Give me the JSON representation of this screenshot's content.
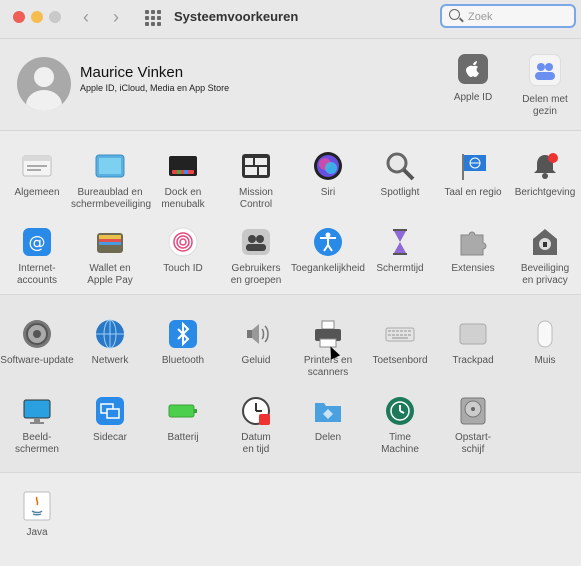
{
  "window": {
    "title": "Systeemvoorkeuren",
    "back_glyph": "‹",
    "forward_glyph": "›"
  },
  "search": {
    "placeholder": "Zoek"
  },
  "user": {
    "name": "Maurice Vinken",
    "subtitle": "Apple ID, iCloud, Media en App Store"
  },
  "top_items": [
    {
      "label": "Apple ID",
      "icon": "apple-id-icon"
    },
    {
      "label": "Delen met\ngezin",
      "icon": "family-sharing-icon"
    }
  ],
  "section1": [
    {
      "label": "Algemeen",
      "icon": "general-icon"
    },
    {
      "label": "Bureaublad en\nschermbeveiliging",
      "icon": "desktop-screensaver-icon"
    },
    {
      "label": "Dock en\nmenubalk",
      "icon": "dock-menubar-icon"
    },
    {
      "label": "Mission\nControl",
      "icon": "mission-control-icon"
    },
    {
      "label": "Siri",
      "icon": "siri-icon"
    },
    {
      "label": "Spotlight",
      "icon": "spotlight-icon"
    },
    {
      "label": "Taal en regio",
      "icon": "language-region-icon"
    },
    {
      "label": "Berichtgeving",
      "icon": "notifications-icon"
    },
    {
      "label": "Internet-\naccounts",
      "icon": "internet-accounts-icon"
    },
    {
      "label": "Wallet en\nApple Pay",
      "icon": "wallet-icon"
    },
    {
      "label": "Touch ID",
      "icon": "touch-id-icon"
    },
    {
      "label": "Gebruikers\nen groepen",
      "icon": "users-groups-icon"
    },
    {
      "label": "Toegankelijkheid",
      "icon": "accessibility-icon"
    },
    {
      "label": "Schermtijd",
      "icon": "screen-time-icon"
    },
    {
      "label": "Extensies",
      "icon": "extensions-icon"
    },
    {
      "label": "Beveiliging\nen privacy",
      "icon": "security-privacy-icon"
    }
  ],
  "section2": [
    {
      "label": "Software-update",
      "icon": "software-update-icon"
    },
    {
      "label": "Netwerk",
      "icon": "network-icon"
    },
    {
      "label": "Bluetooth",
      "icon": "bluetooth-icon"
    },
    {
      "label": "Geluid",
      "icon": "sound-icon"
    },
    {
      "label": "Printers en\nscanners",
      "icon": "printer-icon"
    },
    {
      "label": "Toetsenbord",
      "icon": "keyboard-icon"
    },
    {
      "label": "Trackpad",
      "icon": "trackpad-icon"
    },
    {
      "label": "Muis",
      "icon": "mouse-icon"
    },
    {
      "label": "Beeld-\nschermen",
      "icon": "displays-icon"
    },
    {
      "label": "Sidecar",
      "icon": "sidecar-icon"
    },
    {
      "label": "Batterij",
      "icon": "battery-icon"
    },
    {
      "label": "Datum\nen tijd",
      "icon": "date-time-icon"
    },
    {
      "label": "Delen",
      "icon": "sharing-icon"
    },
    {
      "label": "Time\nMachine",
      "icon": "time-machine-icon"
    },
    {
      "label": "Opstart-\nschijf",
      "icon": "startup-disk-icon"
    }
  ],
  "section3": [
    {
      "label": "Java",
      "icon": "java-icon"
    }
  ],
  "colors": {
    "close": "#ee5f57",
    "minimize": "#f5bd4f",
    "zoom": "#c9c9c9",
    "focus_ring": "#7aa7e6"
  }
}
